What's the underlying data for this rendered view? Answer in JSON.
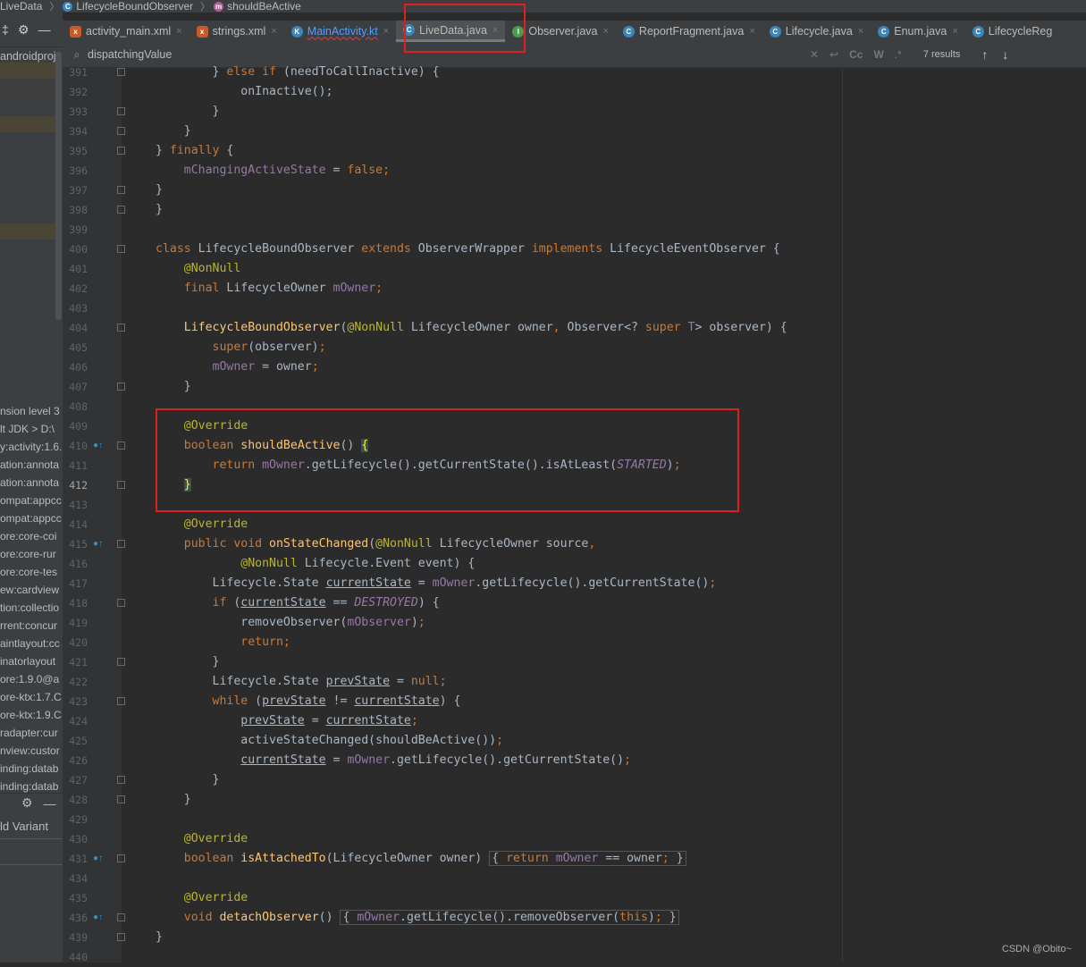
{
  "breadcrumb": [
    "LiveData",
    "LifecycleBoundObserver",
    "shouldBeActive"
  ],
  "project": {
    "root": "androidproj",
    "libraries": [
      "nsion level 3",
      "lt JDK > D:\\",
      "y:activity:1.6.",
      "ation:annota",
      "ation:annota",
      "ompat:appcc",
      "ompat:appcc",
      "ore:core-coi",
      "ore:core-rur",
      "ore:core-tes",
      "ew:cardview",
      "tion:collectio",
      "rrent:concur",
      "aintlayout:cc",
      "inatorlayout",
      "ore:1.9.0@a",
      "ore-ktx:1.7.C",
      "ore-ktx:1.9.C",
      "radapter:cur",
      "nview:custor",
      "inding:datab",
      "inding:datab"
    ],
    "build_variant": "ld Variant"
  },
  "tabs": [
    {
      "label": "activity_main.xml",
      "icon": "xml-icon"
    },
    {
      "label": "strings.xml",
      "icon": "xml-icon"
    },
    {
      "label": "MainActivity.kt",
      "icon": "kotlin-icon"
    },
    {
      "label": "LiveData.java",
      "icon": "java-class-icon",
      "active": true
    },
    {
      "label": "Observer.java",
      "icon": "java-interface-icon"
    },
    {
      "label": "ReportFragment.java",
      "icon": "java-class-icon"
    },
    {
      "label": "Lifecycle.java",
      "icon": "java-class-icon"
    },
    {
      "label": "Enum.java",
      "icon": "java-class-icon"
    },
    {
      "label": "LifecycleReg",
      "icon": "java-class-icon"
    }
  ],
  "search": {
    "value": "dispatchingValue",
    "results": "7 results",
    "case_label": "Cc",
    "word_label": "W",
    "regex_label": ".*"
  },
  "lines": [
    {
      "n": "391",
      "html": "<span class='txt'>        } </span><span class='kw'>else if</span><span class='txt'> (needToCallInactive) {</span>"
    },
    {
      "n": "392",
      "html": "<span class='txt'>            onInactive();</span>"
    },
    {
      "n": "393",
      "html": "<span class='txt'>        }</span>"
    },
    {
      "n": "394",
      "html": "<span class='txt'>    }</span>"
    },
    {
      "n": "395",
      "html": "<span class='txt'>} </span><span class='kw'>finally</span><span class='txt'> {</span>"
    },
    {
      "n": "396",
      "html": "<span class='fld'>    mChangingActiveState</span><span class='txt'> = </span><span class='kw'>false;</span>"
    },
    {
      "n": "397",
      "html": "<span class='txt'>}</span>"
    },
    {
      "n": "398",
      "html": "<span class='txt'>}</span>"
    },
    {
      "n": "399",
      "html": ""
    },
    {
      "n": "400",
      "html": "<span class='kw'>class</span><span class='txt'> LifecycleBoundObserver </span><span class='kw'>extends</span><span class='txt'> ObserverWrapper </span><span class='kw'>implements</span><span class='txt'> LifecycleEventObserver {</span>"
    },
    {
      "n": "401",
      "html": "<span class='an'>    @NonNull</span>"
    },
    {
      "n": "402",
      "html": "<span class='kw'>    final</span><span class='txt'> LifecycleOwner </span><span class='fld'>mOwner</span><span class='kw'>;</span>"
    },
    {
      "n": "403",
      "html": ""
    },
    {
      "n": "404",
      "html": "<span class='fn'>    LifecycleBoundObserver</span><span class='txt'>(</span><span class='an'>@NonNull</span><span class='txt'> LifecycleOwner owner</span><span class='kw'>,</span><span class='txt'> Observer&lt;? </span><span class='kw'>super</span><span class='txt'> </span><span class='fld'>T</span><span class='txt'>&gt; observer) {</span>"
    },
    {
      "n": "405",
      "html": "<span class='kw'>        super</span><span class='txt'>(observer)</span><span class='kw'>;</span>"
    },
    {
      "n": "406",
      "html": "<span class='fld'>        mOwner</span><span class='txt'> = owner</span><span class='kw'>;</span>"
    },
    {
      "n": "407",
      "html": "<span class='txt'>    }</span>"
    },
    {
      "n": "408",
      "html": ""
    },
    {
      "n": "409",
      "html": "<span class='an'>    @Override</span>"
    },
    {
      "n": "410",
      "html": "<span class='kw'>    boolean</span><span class='txt'> </span><span class='fn'>shouldBeActive</span><span class='txt'>() </span><span class='brace-hl'>{</span>"
    },
    {
      "n": "411",
      "html": "<span class='kw'>        return</span><span class='txt'> </span><span class='fld'>mOwner</span><span class='txt'>.getLifecycle().getCurrentState().isAtLeast(</span><span class='ital'>STARTED</span><span class='txt'>)</span><span class='kw'>;</span>"
    },
    {
      "n": "412",
      "html": "<span class='txt'>    </span><span class='brace-hl'>}</span>"
    },
    {
      "n": "413",
      "html": ""
    },
    {
      "n": "414",
      "html": "<span class='an'>    @Override</span>"
    },
    {
      "n": "415",
      "html": "<span class='kw'>    public void</span><span class='txt'> </span><span class='fn'>onStateChanged</span><span class='txt'>(</span><span class='an'>@NonNull</span><span class='txt'> LifecycleOwner source</span><span class='kw'>,</span>"
    },
    {
      "n": "416",
      "html": "<span class='an'>            @NonNull</span><span class='txt'> Lifecycle.Event event) {</span>"
    },
    {
      "n": "417",
      "html": "<span class='txt'>        Lifecycle.State </span><span class='txt ul'>currentState</span><span class='txt'> = </span><span class='fld'>mOwner</span><span class='txt'>.getLifecycle().getCurrentState()</span><span class='kw'>;</span>"
    },
    {
      "n": "418",
      "html": "<span class='kw'>        if</span><span class='txt'> (</span><span class='txt ul'>currentState</span><span class='txt'> == </span><span class='ital'>DESTROYED</span><span class='txt'>) {</span>"
    },
    {
      "n": "419",
      "html": "<span class='txt'>            removeObserver(</span><span class='fld'>mObserver</span><span class='txt'>)</span><span class='kw'>;</span>"
    },
    {
      "n": "420",
      "html": "<span class='kw'>            return;</span>"
    },
    {
      "n": "421",
      "html": "<span class='txt'>        }</span>"
    },
    {
      "n": "422",
      "html": "<span class='txt'>        Lifecycle.State </span><span class='txt ul'>prevState</span><span class='txt'> = </span><span class='kw'>null;</span>"
    },
    {
      "n": "423",
      "html": "<span class='kw'>        while</span><span class='txt'> (</span><span class='txt ul'>prevState</span><span class='txt'> != </span><span class='txt ul'>currentState</span><span class='txt'>) {</span>"
    },
    {
      "n": "424",
      "html": "<span class='txt'>            </span><span class='txt ul'>prevState</span><span class='txt'> = </span><span class='txt ul'>currentState</span><span class='kw'>;</span>"
    },
    {
      "n": "425",
      "html": "<span class='txt'>            activeStateChanged(shouldBeActive())</span><span class='kw'>;</span>"
    },
    {
      "n": "426",
      "html": "<span class='txt'>            </span><span class='txt ul'>currentState</span><span class='txt'> = </span><span class='fld'>mOwner</span><span class='txt'>.getLifecycle().getCurrentState()</span><span class='kw'>;</span>"
    },
    {
      "n": "427",
      "html": "<span class='txt'>        }</span>"
    },
    {
      "n": "428",
      "html": "<span class='txt'>    }</span>"
    },
    {
      "n": "429",
      "html": ""
    },
    {
      "n": "430",
      "html": "<span class='an'>    @Override</span>"
    },
    {
      "n": "431",
      "html": "<span class='kw'>    boolean</span><span class='txt'> </span><span class='fn'>isAttachedTo</span><span class='txt'>(LifecycleOwner owner) </span><span class='fold-box'>{ <span class='kw'>return</span> <span class='fld'>mOwner</span> == owner<span class='kw'>;</span> }</span>"
    },
    {
      "n": "434",
      "html": ""
    },
    {
      "n": "435",
      "html": "<span class='an'>    @Override</span>"
    },
    {
      "n": "436",
      "html": "<span class='kw'>    void</span><span class='txt'> </span><span class='fn'>detachObserver</span><span class='txt'>() </span><span class='fold-box'>{ <span class='fld'>mOwner</span>.getLifecycle().removeObserver(<span class='kw'>this</span>)<span class='kw'>;</span> }</span>"
    },
    {
      "n": "439",
      "html": "<span class='txt'>}</span>"
    },
    {
      "n": "440",
      "html": ""
    }
  ],
  "watermark": "CSDN @Obito~"
}
